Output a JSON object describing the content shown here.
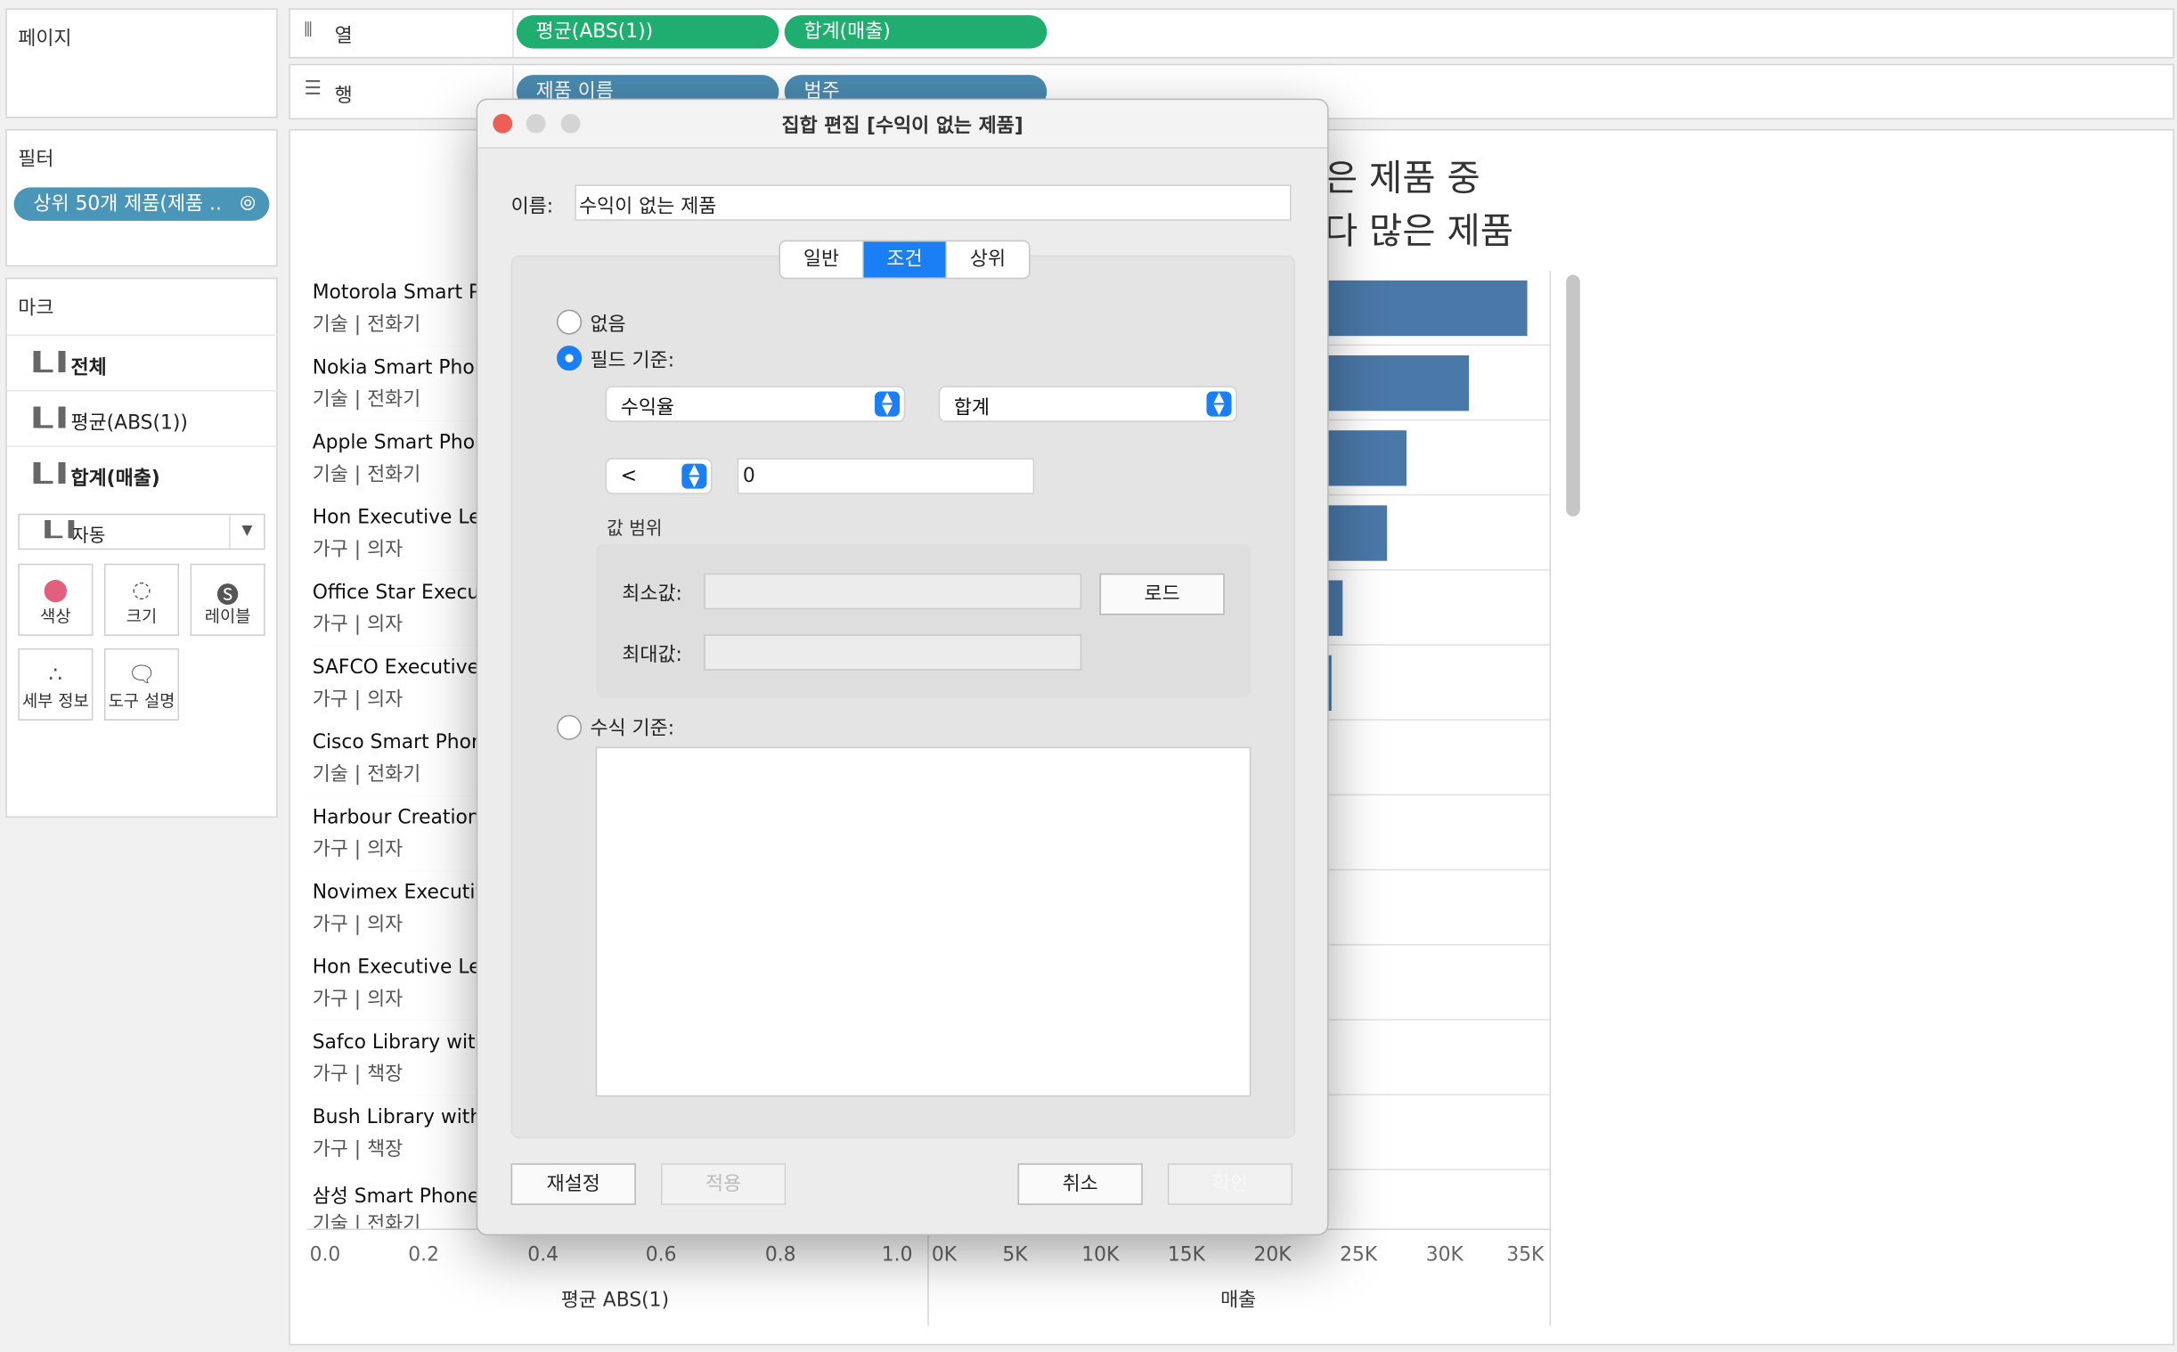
{
  "pages_panel": {
    "title": "페이지"
  },
  "columns_shelf": {
    "label": "열",
    "pills": [
      "평균(ABS(1))",
      "합계(매출)"
    ]
  },
  "rows_shelf": {
    "label": "행",
    "pills": [
      "제품 이름",
      "범주"
    ]
  },
  "filters_panel": {
    "title": "필터",
    "pill": "상위 50개 제품(제품 .."
  },
  "marks_panel": {
    "title": "마크",
    "rows": [
      "전체",
      "평균(ABS(1))",
      "합계(매출)"
    ],
    "mark_type": "자동",
    "buttons": [
      "색상",
      "크기",
      "레이블",
      "세부 정보",
      "도구 설명"
    ]
  },
  "view": {
    "title_line1": "많은 제품 중",
    "title_line2": "보다 많은 제품",
    "products": [
      {
        "name": "Motorola Smart Phone",
        "category": "기술 | 전화기"
      },
      {
        "name": "Nokia Smart Phone",
        "category": "기술 | 전화기"
      },
      {
        "name": "Apple Smart Phone",
        "category": "기술 | 전화기"
      },
      {
        "name": "Hon Executive Leather",
        "category": "가구 | 의자"
      },
      {
        "name": "Office Star Executive",
        "category": "가구 | 의자"
      },
      {
        "name": "SAFCO Executive",
        "category": "가구 | 의자"
      },
      {
        "name": "Cisco Smart Phone",
        "category": "기술 | 전화기"
      },
      {
        "name": "Harbour Creations",
        "category": "가구 | 의자"
      },
      {
        "name": "Novimex Executive",
        "category": "가구 | 의자"
      },
      {
        "name": "Hon Executive Leather",
        "category": "가구 | 의자"
      },
      {
        "name": "Safco Library with",
        "category": "가구 | 책장"
      },
      {
        "name": "Bush Library with",
        "category": "가구 | 책장"
      },
      {
        "name": "삼성 Smart Phone",
        "category": "기술 | 전화기"
      }
    ],
    "abs_axis": {
      "ticks": [
        "0.0",
        "0.2",
        "0.4",
        "0.6",
        "0.8",
        "1.0"
      ],
      "title": "평균 ABS(1)"
    },
    "sales_axis": {
      "ticks": [
        "0K",
        "5K",
        "10K",
        "15K",
        "20K",
        "25K",
        "30K",
        "35K"
      ],
      "title": "매출"
    },
    "visible_bar_end_sales": [
      34500,
      31100,
      27500,
      26400,
      23800,
      23200
    ]
  },
  "dialog": {
    "title": "집합 편집 [수익이 없는 제품]",
    "name_label": "이름:",
    "name_value": "수익이 없는 제품",
    "tabs": [
      "일반",
      "조건",
      "상위"
    ],
    "selected_tab": "조건",
    "none_label": "없음",
    "by_field_label": "필드 기준:",
    "field_select": "수익율",
    "agg_select": "합계",
    "operator_select": "<",
    "value": "0",
    "range_label": "값 범위",
    "min_label": "최소값:",
    "max_label": "최대값:",
    "load_button": "로드",
    "by_formula_label": "수식 기준:",
    "reset_button": "재설정",
    "apply_button": "적용",
    "cancel_button": "취소",
    "ok_button": "확인"
  },
  "colors": {
    "green_pill": "#1fae70",
    "blue_pill": "#4a8ab0",
    "bar": "#4a78a8",
    "accent": "#1a7ef5"
  }
}
